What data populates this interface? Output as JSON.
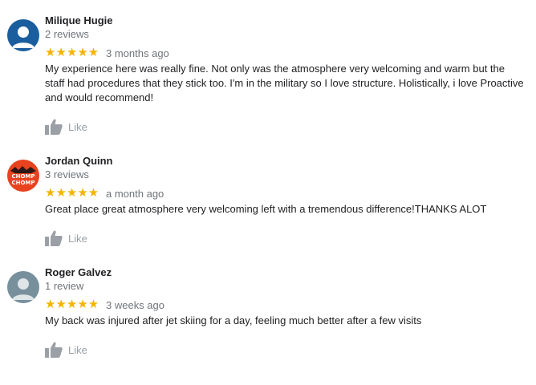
{
  "reviews": [
    {
      "name": "Milique Hugie",
      "review_count": "2 reviews",
      "stars": "★★★★★",
      "rating": 5,
      "date": "3 months ago",
      "text": "My experience here was really fine. Not only was the atmosphere very welcoming and warm but the staff had procedures that they stick too. I'm in the military so I love structure. Holistically, i love Proactive and would recommend!",
      "like_label": "Like",
      "avatar_color": "#1a5e9e"
    },
    {
      "name": "Jordan Quinn",
      "review_count": "3 reviews",
      "stars": "★★★★★",
      "rating": 5,
      "date": "a month ago",
      "text": "Great place great atmosphere  very welcoming left with a tremendous difference!THANKS ALOT",
      "like_label": "Like",
      "avatar_color": "#e8431f",
      "avatar_text": "CHOMP CHOMP"
    },
    {
      "name": "Roger Galvez",
      "review_count": "1 review",
      "stars": "★★★★★",
      "rating": 5,
      "date": "3 weeks ago",
      "text": "My back was injured after jet skiing for a day, feeling much better after a few visits",
      "like_label": "Like",
      "avatar_color": "#78909c"
    }
  ],
  "colors": {
    "star": "#f4b400",
    "muted": "#70757a",
    "like": "#9aa0a6"
  }
}
